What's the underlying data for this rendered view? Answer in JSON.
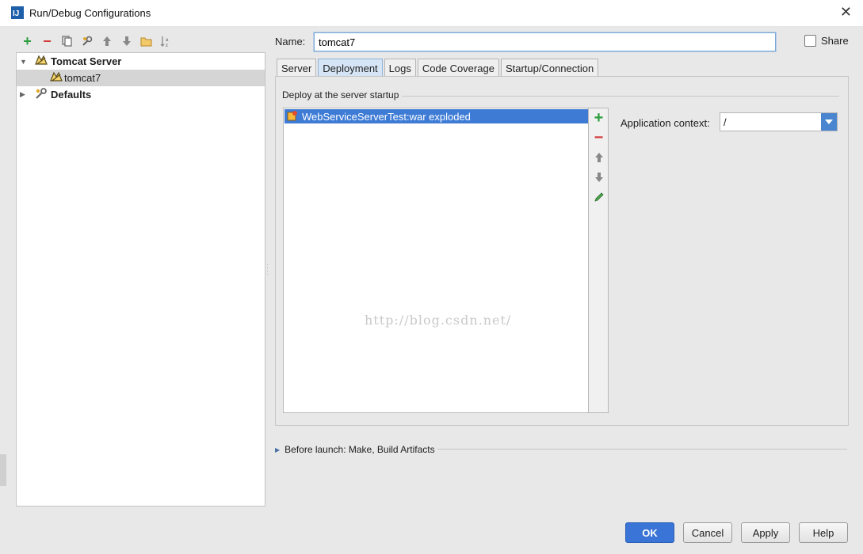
{
  "window": {
    "title": "Run/Debug Configurations",
    "close_glyph": "✕"
  },
  "toolbar": {
    "icons": [
      "add-icon",
      "remove-icon",
      "copy-icon",
      "edit-defaults-icon",
      "move-up-icon",
      "move-down-icon",
      "folder-icon",
      "sort-icon"
    ]
  },
  "tree": {
    "items": [
      {
        "label": "Tomcat Server",
        "bold": true,
        "expanded": true
      },
      {
        "label": "tomcat7",
        "selected": true
      },
      {
        "label": "Defaults",
        "bold": true,
        "expanded": false
      }
    ]
  },
  "name": {
    "label": "Name:",
    "value": "tomcat7"
  },
  "share": {
    "label": "Share",
    "checked": false
  },
  "tabs": [
    {
      "label": "Server"
    },
    {
      "label": "Deployment",
      "active": true
    },
    {
      "label": "Logs"
    },
    {
      "label": "Code Coverage"
    },
    {
      "label": "Startup/Connection"
    }
  ],
  "deployment": {
    "section_title": "Deploy at the server startup",
    "items": [
      {
        "label": "WebServiceServerTest:war exploded",
        "selected": true
      }
    ],
    "watermark": "http://blog.csdn.net/",
    "application_context": {
      "label": "Application context:",
      "value": "/"
    }
  },
  "before_launch": {
    "label": "Before launch: Make, Build Artifacts"
  },
  "buttons": {
    "ok": "OK",
    "cancel": "Cancel",
    "apply": "Apply",
    "help": "Help"
  },
  "colors": {
    "accent": "#3a74d6",
    "selection": "#3d7bd5",
    "add_green": "#2e9e3e",
    "remove_red": "#d43c3c"
  }
}
